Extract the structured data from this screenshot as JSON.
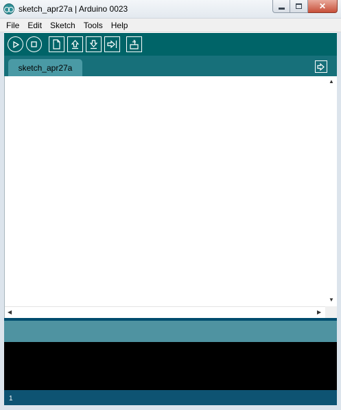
{
  "window": {
    "title": "sketch_apr27a | Arduino 0023",
    "close_glyph": "✕"
  },
  "menu": {
    "items": [
      {
        "label": "File"
      },
      {
        "label": "Edit"
      },
      {
        "label": "Sketch"
      },
      {
        "label": "Tools"
      },
      {
        "label": "Help"
      }
    ]
  },
  "toolbar": {
    "buttons": [
      {
        "name": "verify-button",
        "icon": "play-icon"
      },
      {
        "name": "stop-button",
        "icon": "stop-icon"
      },
      {
        "name": "new-button",
        "icon": "new-file-icon"
      },
      {
        "name": "open-button",
        "icon": "arrow-up-icon"
      },
      {
        "name": "save-button",
        "icon": "arrow-down-icon"
      },
      {
        "name": "upload-button",
        "icon": "arrow-right-icon"
      },
      {
        "name": "serial-monitor-button",
        "icon": "monitor-icon"
      }
    ]
  },
  "tabs": [
    {
      "label": "sketch_apr27a"
    }
  ],
  "status": {
    "line_number": "1"
  },
  "colors": {
    "toolbar": "#006468",
    "tabstrip": "#17707a",
    "tab": "#4a9aa5",
    "status": "#4f93a1",
    "console": "#000000",
    "footer": "#0e5372"
  }
}
